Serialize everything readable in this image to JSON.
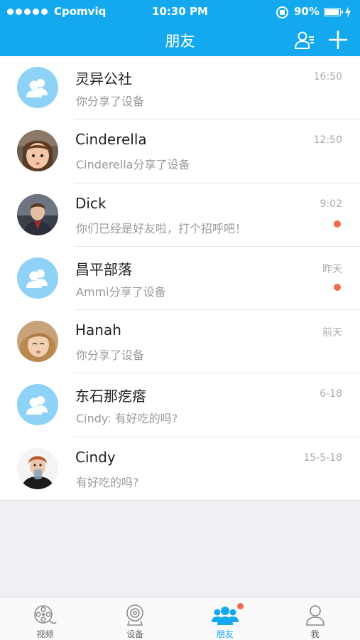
{
  "status_bar": {
    "carrier": "Cpomviq",
    "time": "10:30 PM",
    "battery": "90%"
  },
  "nav": {
    "title": "朋友"
  },
  "conversations": [
    {
      "name": "灵异公社",
      "message": "你分享了设备",
      "time": "16:50",
      "avatar": "group-icon",
      "unread": false
    },
    {
      "name": "Cinderella",
      "message": "Cinderella分享了设备",
      "time": "12:50",
      "avatar": "photo",
      "unread": false
    },
    {
      "name": "Dick",
      "message": "你们已经是好友啦，打个招呼吧！",
      "time": "9:02",
      "avatar": "photo",
      "unread": true
    },
    {
      "name": "昌平部落",
      "message": "Ammi分享了设备",
      "time": "昨天",
      "avatar": "group-icon",
      "unread": true
    },
    {
      "name": "Hanah",
      "message": "你分享了设备",
      "time": "前天",
      "avatar": "photo",
      "unread": false
    },
    {
      "name": "东石那疙瘩",
      "message": "Cindy: 有好吃的吗?",
      "time": "6-18",
      "avatar": "group-icon",
      "unread": false
    },
    {
      "name": "Cindy",
      "message": "有好吃的吗?",
      "time": "15-5-18",
      "avatar": "photo",
      "unread": false
    }
  ],
  "tabs": [
    {
      "label": "视频",
      "icon": "film-reel-icon",
      "active": false
    },
    {
      "label": "设备",
      "icon": "camera-icon",
      "active": false
    },
    {
      "label": "朋友",
      "icon": "friends-icon",
      "active": true,
      "badge": true
    },
    {
      "label": "我",
      "icon": "profile-icon",
      "active": false
    }
  ],
  "colors": {
    "accent": "#14a9ef",
    "unread_dot": "#f06b4b",
    "group_avatar": "#8fd2f7"
  }
}
